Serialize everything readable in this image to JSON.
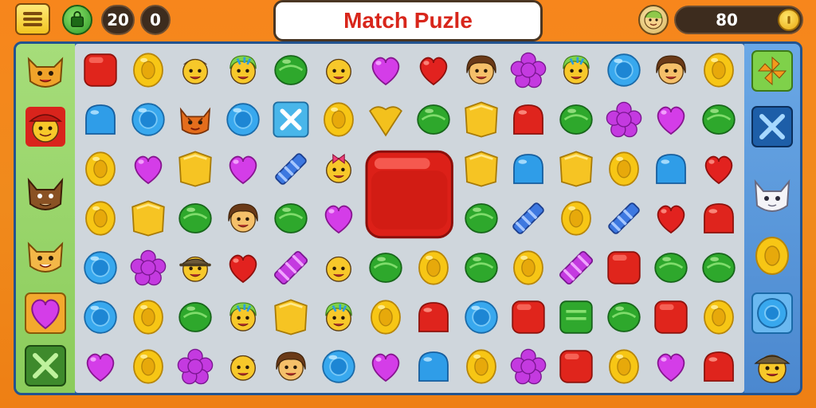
{
  "header": {
    "title": "Match Puzle",
    "moves_counter": "20",
    "secondary_counter": "0",
    "score": "80"
  },
  "colors": {
    "background_orange": "#f7861c",
    "board_border_blue": "#2f6bb3",
    "left_panel_green": "#a6dd7a",
    "right_panel_blue": "#5a98db",
    "title_red": "#d8261b"
  },
  "board": {
    "columns": 12,
    "rows": 7,
    "cells": [
      [
        "red-square",
        "yellow-ring",
        "winking-face",
        "colorful-hair-face",
        "green-oval",
        "smiling-face",
        "purple-heart",
        "red-heart",
        "brown-hair-face",
        "purple-flower",
        "colorful-hair-face",
        "blue-ring",
        "brown-hair-face",
        "yellow-ring"
      ],
      [
        "blue-gumdrop",
        "blue-ring",
        "tiger-cat-face",
        "blue-ring",
        "blue-x-tile",
        "yellow-ring",
        "yellow-heart",
        "green-oval",
        "yellow-square",
        "red-gumdrop",
        "green-oval",
        "purple-flower",
        "purple-heart",
        "green-oval"
      ],
      [
        "yellow-ring",
        "purple-heart",
        "yellow-square",
        "purple-heart",
        "blue-striped-candy",
        "pink-bow-face",
        "big-red-candy",
        "big-red-candy",
        "yellow-square",
        "blue-gumdrop",
        "yellow-square",
        "yellow-ring",
        "blue-gumdrop",
        "red-heart"
      ],
      [
        "yellow-ring",
        "yellow-square",
        "green-oval",
        "brown-hair-face",
        "green-oval",
        "purple-heart",
        "big-red-candy",
        "big-red-candy",
        "green-oval",
        "blue-striped-candy",
        "yellow-ring",
        "blue-striped-candy",
        "red-heart",
        "red-gumdrop"
      ],
      [
        "blue-ring",
        "purple-flower",
        "hat-face",
        "red-heart",
        "purple-striped-candy",
        "smiling-face",
        "green-oval",
        "yellow-ring",
        "green-oval",
        "yellow-ring",
        "purple-striped-candy",
        "red-square",
        "green-oval",
        "green-oval"
      ],
      [
        "blue-ring",
        "yellow-ring",
        "green-oval",
        "colorful-hair-face",
        "yellow-square",
        "colorful-hair-face",
        "yellow-ring",
        "red-gumdrop",
        "blue-ring",
        "red-square",
        "green-square",
        "green-oval",
        "red-square",
        "yellow-ring"
      ],
      [
        "purple-heart",
        "yellow-ring",
        "purple-flower",
        "winking-face",
        "brown-hair-face",
        "blue-ring",
        "purple-heart",
        "blue-gumdrop",
        "yellow-ring",
        "purple-flower",
        "red-square",
        "yellow-ring",
        "purple-heart",
        "red-gumdrop"
      ]
    ]
  },
  "left_panel": {
    "items": [
      "tiger-face-booster",
      "red-hat-face-booster",
      "cat-face-booster",
      "tiger-cub-booster",
      "purple-heart-booster",
      "green-x-button"
    ]
  },
  "right_panel": {
    "items": [
      "green-pinwheel-button",
      "blue-x-button",
      "white-cat-booster",
      "yellow-ring-booster",
      "blue-ring-booster",
      "hat-face-booster"
    ]
  }
}
